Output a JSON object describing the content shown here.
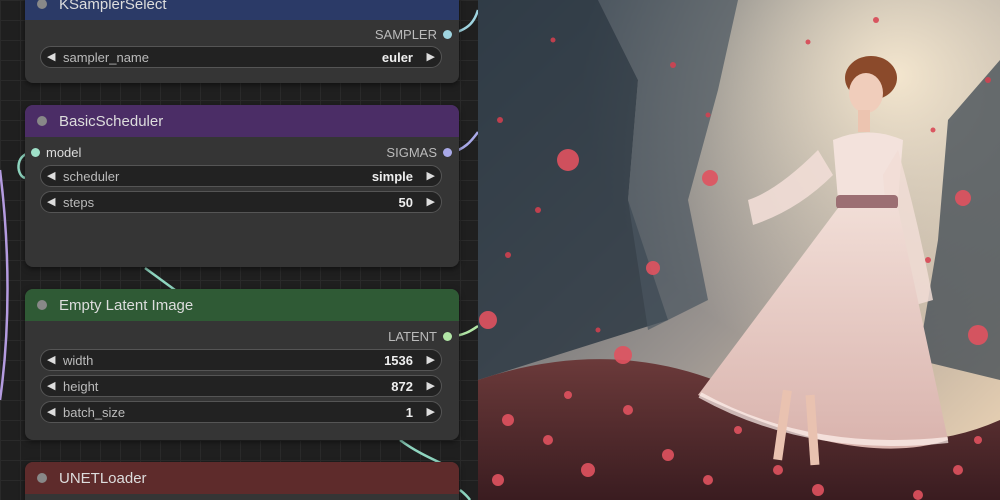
{
  "nodes": {
    "ksampler_select": {
      "title": "KSamplerSelect",
      "header_color": "#2b3a67",
      "output": "SAMPLER",
      "widgets": [
        {
          "name": "sampler_name",
          "value": "euler"
        }
      ]
    },
    "basic_scheduler": {
      "title": "BasicScheduler",
      "header_color": "#4b2d66",
      "input": "model",
      "output": "SIGMAS",
      "widgets": [
        {
          "name": "scheduler",
          "value": "simple"
        },
        {
          "name": "steps",
          "value": "50"
        }
      ]
    },
    "empty_latent": {
      "title": "Empty Latent Image",
      "header_color": "#2f5a35",
      "output": "LATENT",
      "widgets": [
        {
          "name": "width",
          "value": "1536"
        },
        {
          "name": "height",
          "value": "872"
        },
        {
          "name": "batch_size",
          "value": "1"
        }
      ]
    },
    "unet_loader": {
      "title": "UNETLoader",
      "header_color": "#5e2b2b"
    }
  },
  "colors": {
    "sampler_port": "#9fd4e0",
    "sigmas_port": "#a9a9e8",
    "model_port": "#9fe0c8",
    "latent_port": "#b2e6a6",
    "link_teal": "#8fd6c0",
    "link_purple": "#b49be0"
  },
  "preview_image": {
    "icon": "generated-image-preview"
  }
}
